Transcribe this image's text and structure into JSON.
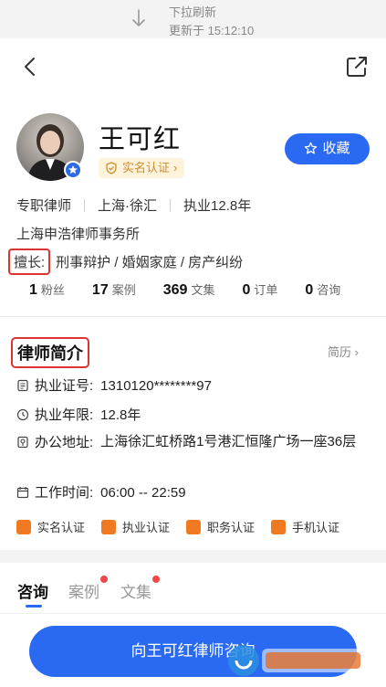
{
  "pull_refresh": {
    "text": "下拉刷新",
    "updated": "更新于 15:12:10"
  },
  "nav": {
    "back_icon": "chevron-left-icon",
    "share_icon": "share-icon"
  },
  "lawyer": {
    "name": "王可红",
    "realname_label": "实名认证",
    "favorite_label": "收藏",
    "title": "专职律师",
    "location": "上海·徐汇",
    "practice": "执业12.8年",
    "firm": "上海申浩律师事务所",
    "skills_label": "擅长:",
    "skills": "刑事辩护 / 婚姻家庭 / 房产纠纷",
    "stats": [
      {
        "num": "1",
        "label": "粉丝"
      },
      {
        "num": "17",
        "label": "案例"
      },
      {
        "num": "369",
        "label": "文集"
      },
      {
        "num": "0",
        "label": "订单"
      },
      {
        "num": "0",
        "label": "咨询"
      }
    ]
  },
  "intro": {
    "title": "律师简介",
    "resume_link": "简历",
    "license_label": "执业证号:",
    "license_value": "1310120********97",
    "years_label": "执业年限:",
    "years_value": "12.8年",
    "address_label": "办公地址:",
    "address_value": "上海徐汇虹桥路1号港汇恒隆广场一座36层",
    "hours_label": "工作时间:",
    "hours_value": "06:00 -- 22:59",
    "badges": [
      "实名认证",
      "执业认证",
      "职务认证",
      "手机认证"
    ]
  },
  "tabs": [
    {
      "label": "咨询",
      "active": true,
      "dot": false
    },
    {
      "label": "案例",
      "active": false,
      "dot": true
    },
    {
      "label": "文集",
      "active": false,
      "dot": true
    }
  ],
  "cta": {
    "label": "向王可红律师咨询"
  },
  "colors": {
    "accent": "#2a6af2",
    "badge_orange": "#f07a22",
    "highlight_red": "#d33333",
    "gold": "#c98f2e"
  }
}
